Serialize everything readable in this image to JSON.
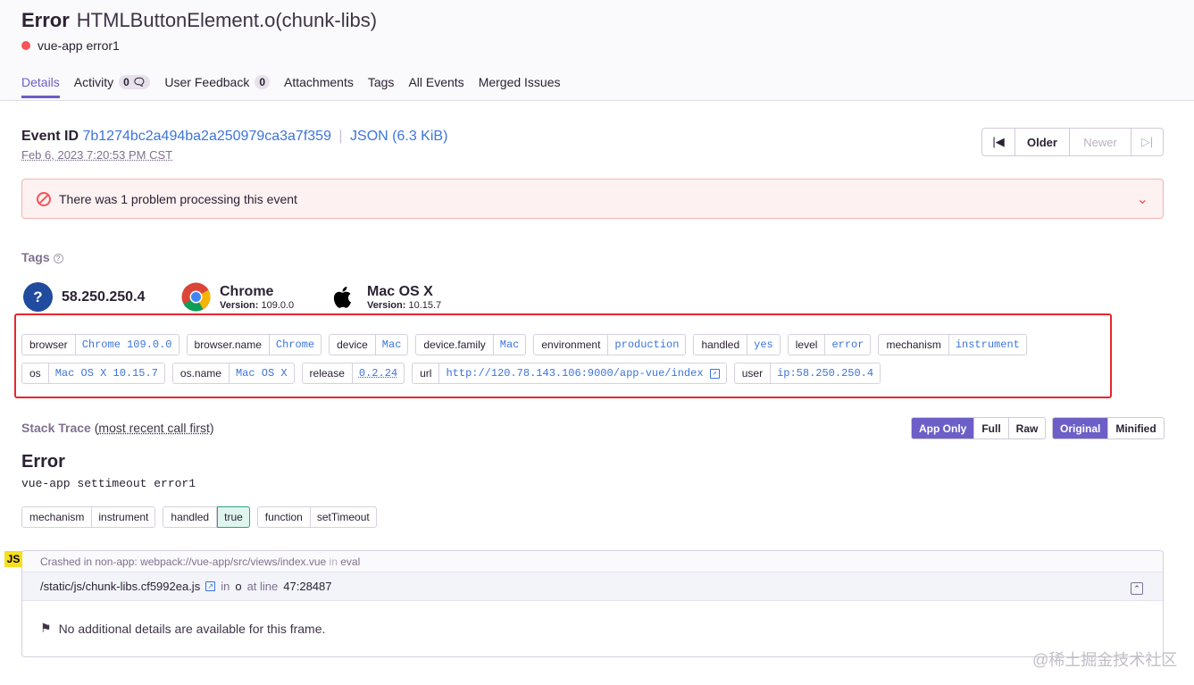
{
  "header": {
    "title": "Error",
    "subtitle": "HTMLButtonElement.o(chunk-libs)",
    "project": "vue-app error1",
    "tabs": [
      {
        "label": "Details",
        "active": true
      },
      {
        "label": "Activity",
        "badge": "0"
      },
      {
        "label": "User Feedback",
        "badge": "0"
      },
      {
        "label": "Attachments"
      },
      {
        "label": "Tags"
      },
      {
        "label": "All Events"
      },
      {
        "label": "Merged Issues"
      }
    ]
  },
  "event": {
    "id_label": "Event ID",
    "id": "7b1274bc2a494ba2a250979ca3a7f359",
    "json_label": "JSON (6.3 KiB)",
    "date": "Feb 6, 2023 7:20:53 PM CST"
  },
  "pager": {
    "first": "⏮",
    "older": "Older",
    "newer": "Newer",
    "last": "⏭"
  },
  "alert": {
    "text": "There was 1 problem processing this event",
    "color": "#f55459"
  },
  "tags_section": {
    "title": "Tags"
  },
  "contexts": [
    {
      "name": "58.250.250.4",
      "icon": "user-unknown-icon"
    },
    {
      "name": "Chrome",
      "version_label": "Version:",
      "version": "109.0.0",
      "icon": "chrome-icon"
    },
    {
      "name": "Mac OS X",
      "version_label": "Version:",
      "version": "10.15.7",
      "icon": "apple-icon"
    }
  ],
  "tags_row1": [
    {
      "key": "browser",
      "value": "Chrome 109.0.0"
    },
    {
      "key": "browser.name",
      "value": "Chrome"
    },
    {
      "key": "device",
      "value": "Mac"
    },
    {
      "key": "device.family",
      "value": "Mac"
    },
    {
      "key": "environment",
      "value": "production"
    },
    {
      "key": "handled",
      "value": "yes"
    },
    {
      "key": "level",
      "value": "error"
    },
    {
      "key": "mechanism",
      "value": "instrument"
    }
  ],
  "tags_row2": [
    {
      "key": "os",
      "value": "Mac OS X 10.15.7"
    },
    {
      "key": "os.name",
      "value": "Mac OS X"
    },
    {
      "key": "release",
      "value": "0.2.24"
    },
    {
      "key": "url",
      "value": "http://120.78.143.106:9000/app-vue/index"
    },
    {
      "key": "user",
      "value": "ip:58.250.250.4"
    }
  ],
  "stack_trace": {
    "title": "Stack Trace",
    "subtitle": "most recent call first",
    "view_buttons": [
      "App Only",
      "Full",
      "Raw"
    ],
    "format_buttons": [
      "Original",
      "Minified"
    ],
    "error_type": "Error",
    "error_message": "vue-app settimeout error1",
    "mechanism": [
      {
        "key": "mechanism",
        "value": "instrument"
      },
      {
        "key": "handled",
        "value": "true"
      },
      {
        "key": "function",
        "value": "setTimeout"
      }
    ],
    "frame": {
      "platform": "JS",
      "crashed_prefix": "Crashed in non-app:",
      "crashed_path": "webpack://vue-app/src/views/index.vue",
      "crashed_in": "in",
      "crashed_fn": "eval",
      "file": "/static/js/chunk-libs.cf5992ea.js",
      "in_label": "in",
      "function": "o",
      "at_line_label": "at line",
      "line": "47:28487",
      "no_details": "No additional details are available for this frame."
    }
  },
  "watermark": "@稀土掘金技术社区"
}
